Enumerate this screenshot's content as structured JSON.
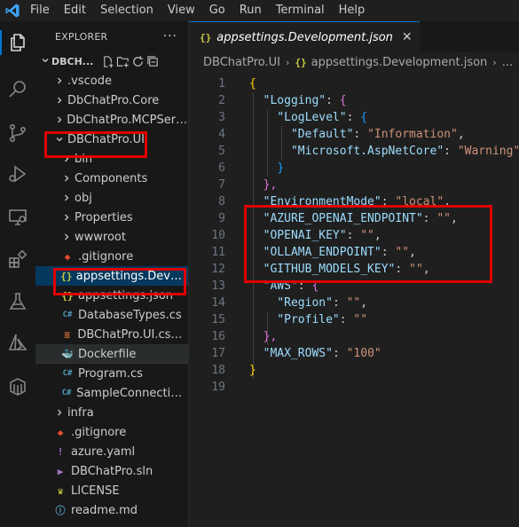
{
  "colors": {
    "accent": "#0078d4",
    "highlight": "#e00000",
    "folder_icon": "#c5c5c5",
    "json_icon": "#cbcb41"
  },
  "menu": {
    "items": [
      "File",
      "Edit",
      "Selection",
      "View",
      "Go",
      "Run",
      "Terminal",
      "Help"
    ]
  },
  "activity_bar": {
    "icons": [
      "explorer-icon",
      "search-icon",
      "source-control-icon",
      "run-debug-icon",
      "remote-explorer-icon",
      "extensions-icon",
      "testing-icon",
      "azure-icon",
      "containers-icon"
    ]
  },
  "sidebar": {
    "title": "EXPLORER",
    "more": "···",
    "project": "DBCH...",
    "tree": [
      {
        "label": ".vscode",
        "type": "folder",
        "collapsed": true
      },
      {
        "label": "DbChatPro.Core",
        "type": "folder",
        "collapsed": true
      },
      {
        "label": "DbChatPro.MCPServer",
        "type": "folder",
        "collapsed": true
      },
      {
        "label": "DBChatPro.UI",
        "type": "folder",
        "collapsed": false
      },
      {
        "label": "bin",
        "type": "folder",
        "collapsed": true
      },
      {
        "label": "Components",
        "type": "folder",
        "collapsed": true
      },
      {
        "label": "obj",
        "type": "folder",
        "collapsed": true
      },
      {
        "label": "Properties",
        "type": "folder",
        "collapsed": true
      },
      {
        "label": "wwwroot",
        "type": "folder",
        "collapsed": true
      },
      {
        "label": ".gitignore",
        "type": "git"
      },
      {
        "label": "appsettings.Develop...",
        "type": "json"
      },
      {
        "label": "appsettings.json",
        "type": "json"
      },
      {
        "label": "DatabaseTypes.cs",
        "type": "cs"
      },
      {
        "label": "DBChatPro.UI.csproj",
        "type": "rss"
      },
      {
        "label": "Dockerfile",
        "type": "docker"
      },
      {
        "label": "Program.cs",
        "type": "cs"
      },
      {
        "label": "SampleConnectionS...",
        "type": "cs"
      },
      {
        "label": "infra",
        "type": "folder",
        "collapsed": true
      },
      {
        "label": ".gitignore",
        "type": "git"
      },
      {
        "label": "azure.yaml",
        "type": "yaml"
      },
      {
        "label": "DBChatPro.sln",
        "type": "sln"
      },
      {
        "label": "LICENSE",
        "type": "license"
      },
      {
        "label": "readme.md",
        "type": "md"
      }
    ]
  },
  "editor": {
    "tab": {
      "icon": "{}",
      "label": "appsettings.Development.json",
      "close": "✕"
    },
    "breadcrumb": {
      "folder": "DBChatPro.UI",
      "sep": "›",
      "icon": "{}",
      "file": "appsettings.Development.json",
      "more": "..."
    },
    "line_numbers": [
      "1",
      "2",
      "3",
      "4",
      "5",
      "6",
      "7",
      "8",
      "9",
      "10",
      "11",
      "12",
      "13",
      "14",
      "15",
      "16",
      "17",
      "18",
      "19"
    ],
    "code": {
      "l1": "{",
      "l2_key": "\"Logging\"",
      "l2_colon": ": ",
      "l2_brace": "{",
      "l3_key": "\"LogLevel\"",
      "l3_colon": ": ",
      "l3_brace": "{",
      "l4_key": "\"Default\"",
      "l4_colon": ": ",
      "l4_val": "\"Information\"",
      "l4_comma": ",",
      "l5_key": "\"Microsoft.AspNetCore\"",
      "l5_colon": ": ",
      "l5_val": "\"Warning\"",
      "l6": "}",
      "l7": "},",
      "l8_key": "\"EnvironmentMode\"",
      "l8_colon": ": ",
      "l8_val": "\"local\"",
      "l8_comma": ",",
      "l9_key": "\"AZURE_OPENAI_ENDPOINT\"",
      "l9_colon": ": ",
      "l9_val": "\"\"",
      "l9_comma": ",",
      "l10_key": "\"OPENAI_KEY\"",
      "l10_colon": ": ",
      "l10_val": "\"\"",
      "l10_comma": ",",
      "l11_key": "\"OLLAMA_ENDPOINT\"",
      "l11_colon": ": ",
      "l11_val": "\"\"",
      "l11_comma": ",",
      "l12_key": "\"GITHUB_MODELS_KEY\"",
      "l12_colon": ": ",
      "l12_val": "\"\"",
      "l12_comma": ",",
      "l13_key": "\"AWS\"",
      "l13_colon": ": ",
      "l13_brace": "{",
      "l14_key": "\"Region\"",
      "l14_colon": ": ",
      "l14_val": "\"\"",
      "l14_comma": ",",
      "l15_key": "\"Profile\"",
      "l15_colon": ": ",
      "l15_val": "\"\"",
      "l16": "},",
      "l17_key": "\"MAX_ROWS\"",
      "l17_colon": ": ",
      "l17_val": "\"100\"",
      "l18": "}",
      "l19": ""
    }
  }
}
